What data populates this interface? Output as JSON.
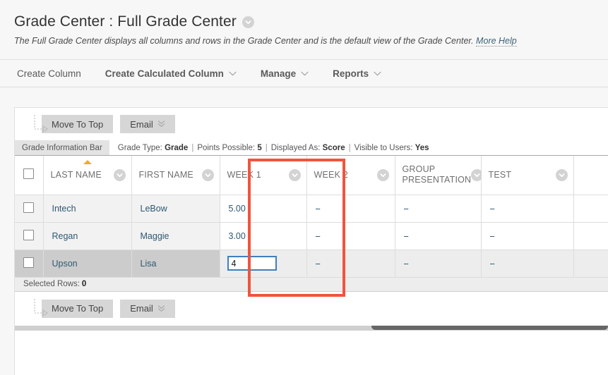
{
  "header": {
    "title": "Grade Center : Full Grade Center",
    "title_menu_icon": "chevron-down-circle-icon",
    "subtitle": "The Full Grade Center displays all columns and rows in the Grade Center and is the default view of the Grade Center.",
    "more_help": "More Help"
  },
  "action_bar": {
    "items": [
      {
        "label": "Create Column",
        "has_menu": false,
        "bold": false
      },
      {
        "label": "Create Calculated Column",
        "has_menu": true,
        "bold": true
      },
      {
        "label": "Manage",
        "has_menu": true,
        "bold": true
      },
      {
        "label": "Reports",
        "has_menu": true,
        "bold": true
      }
    ]
  },
  "toolbar": {
    "move_to_top": "Move To Top",
    "email": "Email",
    "email_icon": "chevron-double-down-icon",
    "connector_icon": "dotted-arrow-icon"
  },
  "info_bar": {
    "tab_label": "Grade Information Bar",
    "grade_type_label": "Grade Type:",
    "grade_type_value": "Grade",
    "points_label": "Points Possible:",
    "points_value": "5",
    "displayed_label": "Displayed As:",
    "displayed_value": "Score",
    "visible_label": "Visible to Users:",
    "visible_value": "Yes",
    "separator": "|"
  },
  "table": {
    "sort_indicator_column": "LAST NAME",
    "sort_icon": "sort-ascending-caret-icon",
    "column_menu_icon": "chevron-down-circle-icon",
    "select_all_checkbox": "checkbox-icon",
    "headers": [
      "LAST NAME",
      "FIRST NAME",
      "WEEK 1",
      "WEEK 2",
      "GROUP PRESENTATION",
      "TEST"
    ],
    "rows": [
      {
        "last_name": "Intech",
        "first_name": "LeBow",
        "week1": "5.00",
        "week2": "--",
        "group_presentation": "--",
        "test": "--",
        "selected": false,
        "editing": false
      },
      {
        "last_name": "Regan",
        "first_name": "Maggie",
        "week1": "3.00",
        "week2": "--",
        "group_presentation": "--",
        "test": "--",
        "selected": false,
        "editing": false
      },
      {
        "last_name": "Upson",
        "first_name": "Lisa",
        "week1": "",
        "week2": "--",
        "group_presentation": "--",
        "test": "--",
        "selected": true,
        "editing": true,
        "edit_value": "4"
      }
    ]
  },
  "footer": {
    "selected_rows_label": "Selected Rows:",
    "selected_rows_count": "0",
    "move_to_top": "Move To Top",
    "email": "Email"
  },
  "colors": {
    "highlight_box": "#f0553c",
    "sort_caret": "#f0ab26",
    "cell_text": "#2e5871",
    "input_focus": "#3f7fbf",
    "page_bg": "#f7f7f7",
    "button_bg": "#d6d6d6",
    "selected_row": "#cccccc",
    "scrollbar_thumb": "#666666"
  }
}
